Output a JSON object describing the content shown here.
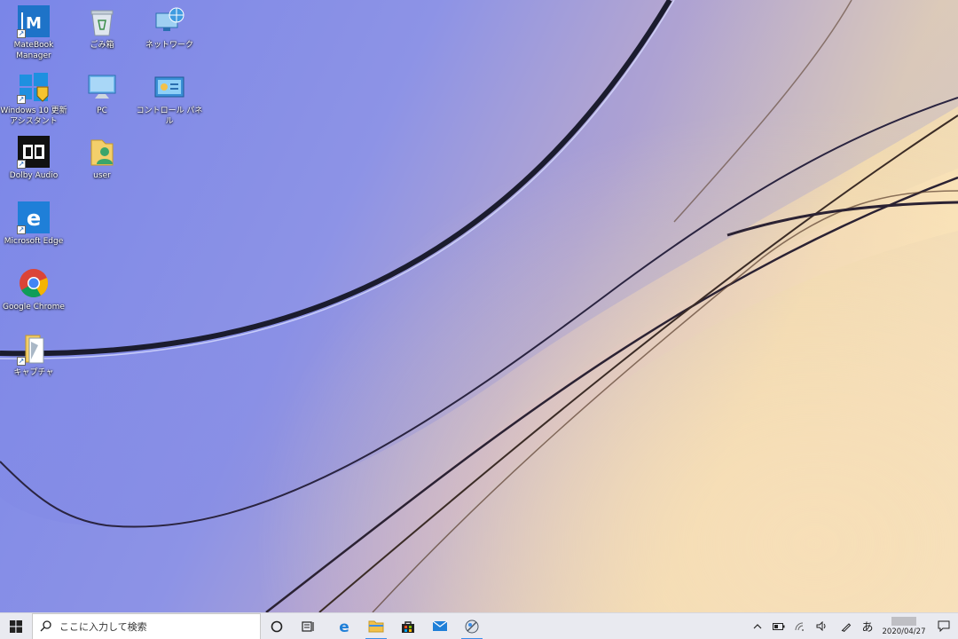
{
  "desktop": {
    "icons": [
      {
        "label": "MateBook\nManager"
      },
      {
        "label": "ごみ箱"
      },
      {
        "label": "ネットワーク"
      },
      {
        "label": "Windows 10 更新\nアシスタント"
      },
      {
        "label": "PC"
      },
      {
        "label": "コントロール パネル"
      },
      {
        "label": "Dolby Audio"
      },
      {
        "label": "user"
      },
      {
        "label": "Microsoft Edge"
      },
      {
        "label": "Google Chrome"
      },
      {
        "label": "キャプチャ"
      }
    ]
  },
  "taskbar": {
    "search_placeholder": "ここに入力して検索",
    "ime_label": "あ",
    "date": "2020/04/27"
  },
  "colors": {
    "taskbar": "#e9eaf0",
    "accent": "#3b8eea"
  }
}
